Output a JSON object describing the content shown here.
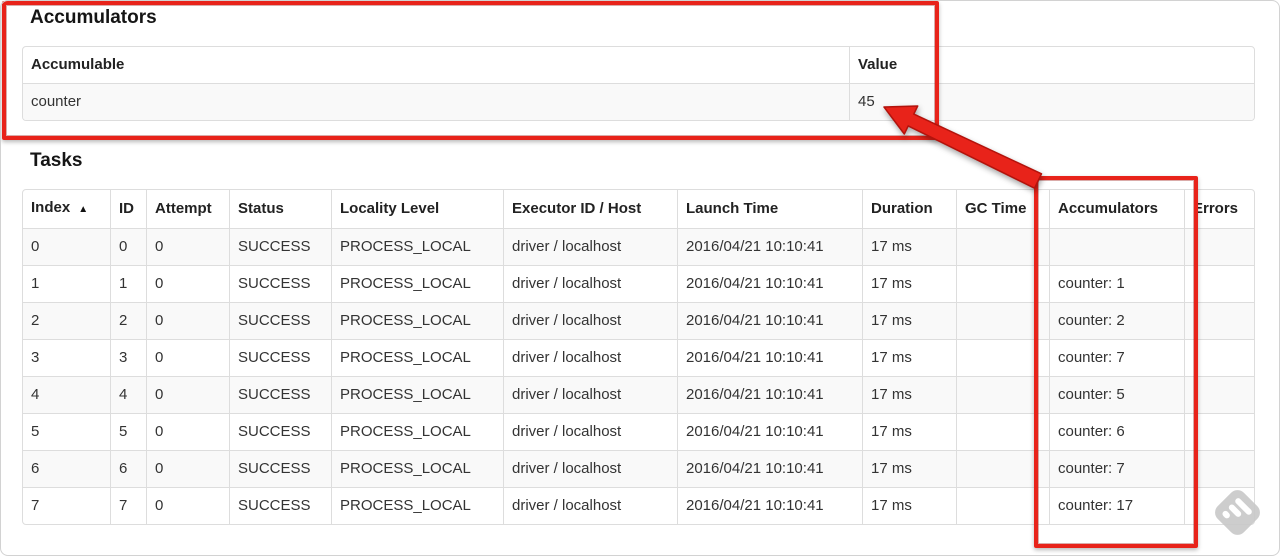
{
  "headings": {
    "accumulators": "Accumulators",
    "tasks": "Tasks"
  },
  "accumulators_table": {
    "headers": {
      "accumulable": "Accumulable",
      "value": "Value"
    },
    "rows": [
      {
        "accumulable": "counter",
        "value": "45"
      }
    ]
  },
  "tasks_table": {
    "headers": [
      "Index",
      "ID",
      "Attempt",
      "Status",
      "Locality Level",
      "Executor ID / Host",
      "Launch Time",
      "Duration",
      "GC Time",
      "Accumulators",
      "Errors"
    ],
    "sort_icon": "▲",
    "rows": [
      {
        "index": "0",
        "id": "0",
        "attempt": "0",
        "status": "SUCCESS",
        "locality_level": "PROCESS_LOCAL",
        "executor_id_host": "driver / localhost",
        "launch_time": "2016/04/21 10:10:41",
        "duration": "17 ms",
        "gc_time": "",
        "accumulators": "",
        "errors": ""
      },
      {
        "index": "1",
        "id": "1",
        "attempt": "0",
        "status": "SUCCESS",
        "locality_level": "PROCESS_LOCAL",
        "executor_id_host": "driver / localhost",
        "launch_time": "2016/04/21 10:10:41",
        "duration": "17 ms",
        "gc_time": "",
        "accumulators": "counter: 1",
        "errors": ""
      },
      {
        "index": "2",
        "id": "2",
        "attempt": "0",
        "status": "SUCCESS",
        "locality_level": "PROCESS_LOCAL",
        "executor_id_host": "driver / localhost",
        "launch_time": "2016/04/21 10:10:41",
        "duration": "17 ms",
        "gc_time": "",
        "accumulators": "counter: 2",
        "errors": ""
      },
      {
        "index": "3",
        "id": "3",
        "attempt": "0",
        "status": "SUCCESS",
        "locality_level": "PROCESS_LOCAL",
        "executor_id_host": "driver / localhost",
        "launch_time": "2016/04/21 10:10:41",
        "duration": "17 ms",
        "gc_time": "",
        "accumulators": "counter: 7",
        "errors": ""
      },
      {
        "index": "4",
        "id": "4",
        "attempt": "0",
        "status": "SUCCESS",
        "locality_level": "PROCESS_LOCAL",
        "executor_id_host": "driver / localhost",
        "launch_time": "2016/04/21 10:10:41",
        "duration": "17 ms",
        "gc_time": "",
        "accumulators": "counter: 5",
        "errors": ""
      },
      {
        "index": "5",
        "id": "5",
        "attempt": "0",
        "status": "SUCCESS",
        "locality_level": "PROCESS_LOCAL",
        "executor_id_host": "driver / localhost",
        "launch_time": "2016/04/21 10:10:41",
        "duration": "17 ms",
        "gc_time": "",
        "accumulators": "counter: 6",
        "errors": ""
      },
      {
        "index": "6",
        "id": "6",
        "attempt": "0",
        "status": "SUCCESS",
        "locality_level": "PROCESS_LOCAL",
        "executor_id_host": "driver / localhost",
        "launch_time": "2016/04/21 10:10:41",
        "duration": "17 ms",
        "gc_time": "",
        "accumulators": "counter: 7",
        "errors": ""
      },
      {
        "index": "7",
        "id": "7",
        "attempt": "0",
        "status": "SUCCESS",
        "locality_level": "PROCESS_LOCAL",
        "executor_id_host": "driver / localhost",
        "launch_time": "2016/04/21 10:10:41",
        "duration": "17 ms",
        "gc_time": "",
        "accumulators": "counter: 17",
        "errors": ""
      }
    ]
  },
  "annotations": {
    "highlight_color": "#e8231a"
  }
}
